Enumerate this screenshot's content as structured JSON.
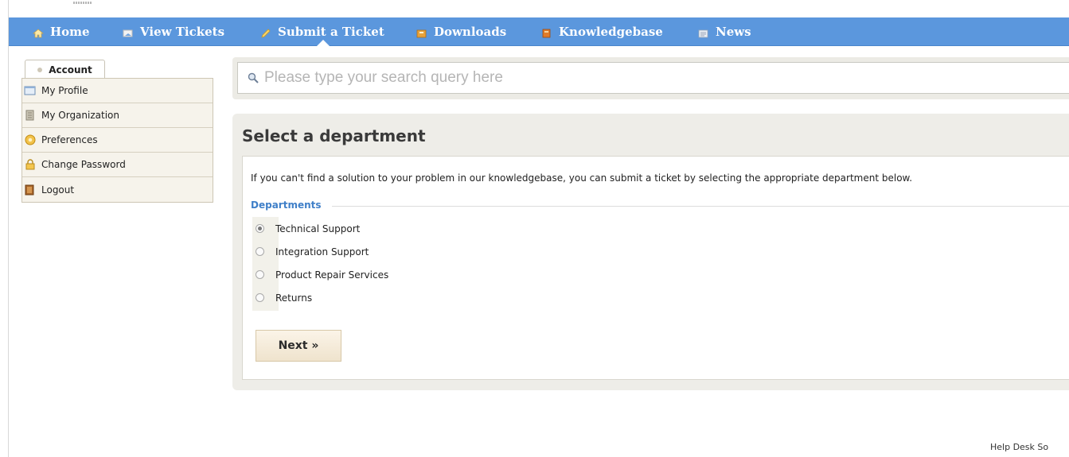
{
  "nav": {
    "items": [
      {
        "label": "Home",
        "icon": "home-icon"
      },
      {
        "label": "View Tickets",
        "icon": "tickets-icon"
      },
      {
        "label": "Submit a Ticket",
        "icon": "pencil-icon"
      },
      {
        "label": "Downloads",
        "icon": "downloads-icon"
      },
      {
        "label": "Knowledgebase",
        "icon": "book-icon"
      },
      {
        "label": "News",
        "icon": "news-icon"
      }
    ],
    "active": "Submit a Ticket",
    "bg_color": "#5b97dd"
  },
  "sidebar": {
    "tab_label": "Account",
    "items": [
      {
        "label": "My Profile",
        "icon": "profile-icon"
      },
      {
        "label": "My Organization",
        "icon": "organization-icon"
      },
      {
        "label": "Preferences",
        "icon": "preferences-icon"
      },
      {
        "label": "Change Password",
        "icon": "lock-icon"
      },
      {
        "label": "Logout",
        "icon": "logout-icon"
      }
    ]
  },
  "search": {
    "placeholder": "Please type your search query here"
  },
  "main": {
    "title": "Select a department",
    "intro": "If you can't find a solution to your problem in our knowledgebase, you can submit a ticket by selecting the appropriate department below.",
    "departments_legend": "Departments",
    "departments": [
      {
        "label": "Technical Support",
        "checked": true
      },
      {
        "label": "Integration Support",
        "checked": false
      },
      {
        "label": "Product Repair Services",
        "checked": false
      },
      {
        "label": "Returns",
        "checked": false
      }
    ],
    "next_label": "Next »",
    "accent_color": "#3f7fc8"
  },
  "footer": {
    "text": "Help Desk So"
  }
}
